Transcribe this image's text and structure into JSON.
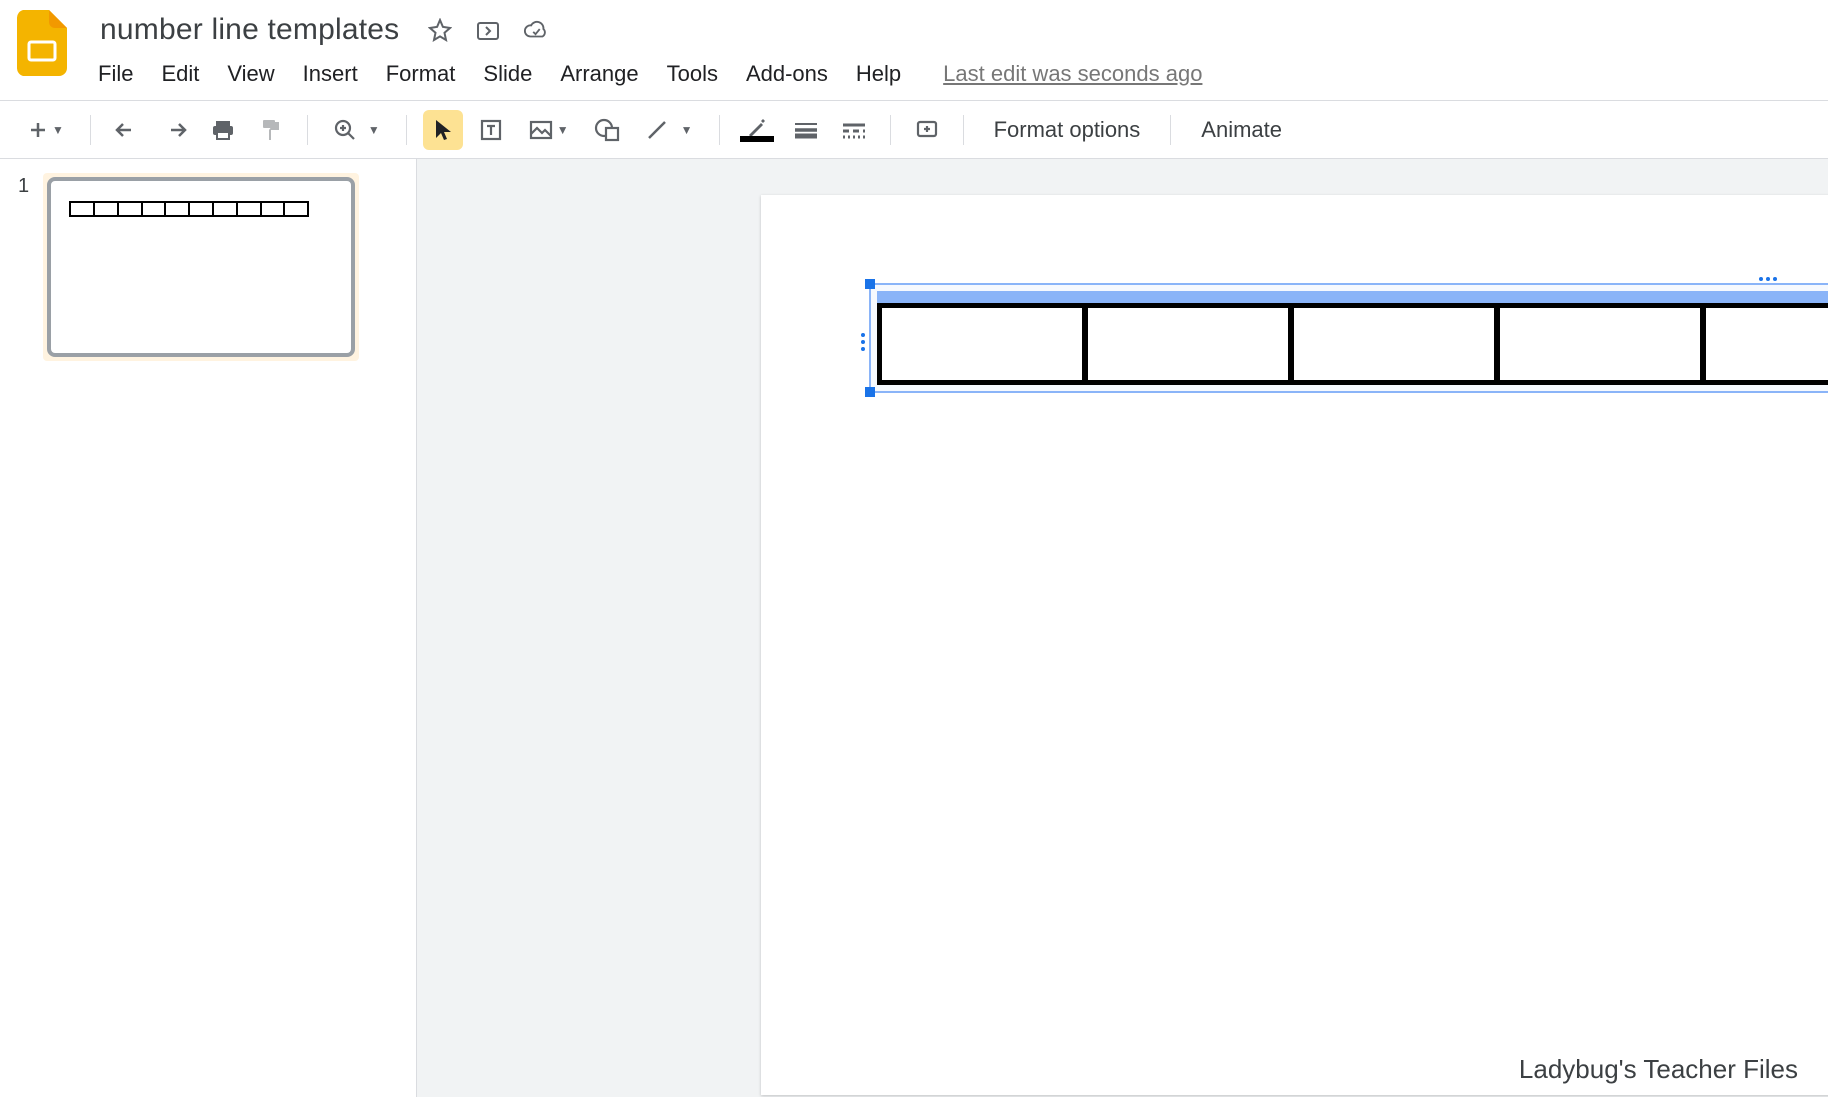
{
  "document": {
    "title": "number line templates",
    "last_edit": "Last edit was seconds ago"
  },
  "menus": {
    "file": "File",
    "edit": "Edit",
    "view": "View",
    "insert": "Insert",
    "format": "Format",
    "slide": "Slide",
    "arrange": "Arrange",
    "tools": "Tools",
    "addons": "Add-ons",
    "help": "Help"
  },
  "toolbar": {
    "format_options": "Format options",
    "animate": "Animate"
  },
  "filmstrip": {
    "slides": [
      {
        "number": "1"
      }
    ]
  },
  "watermark": "Ladybug's Teacher Files",
  "table": {
    "columns": 5
  }
}
